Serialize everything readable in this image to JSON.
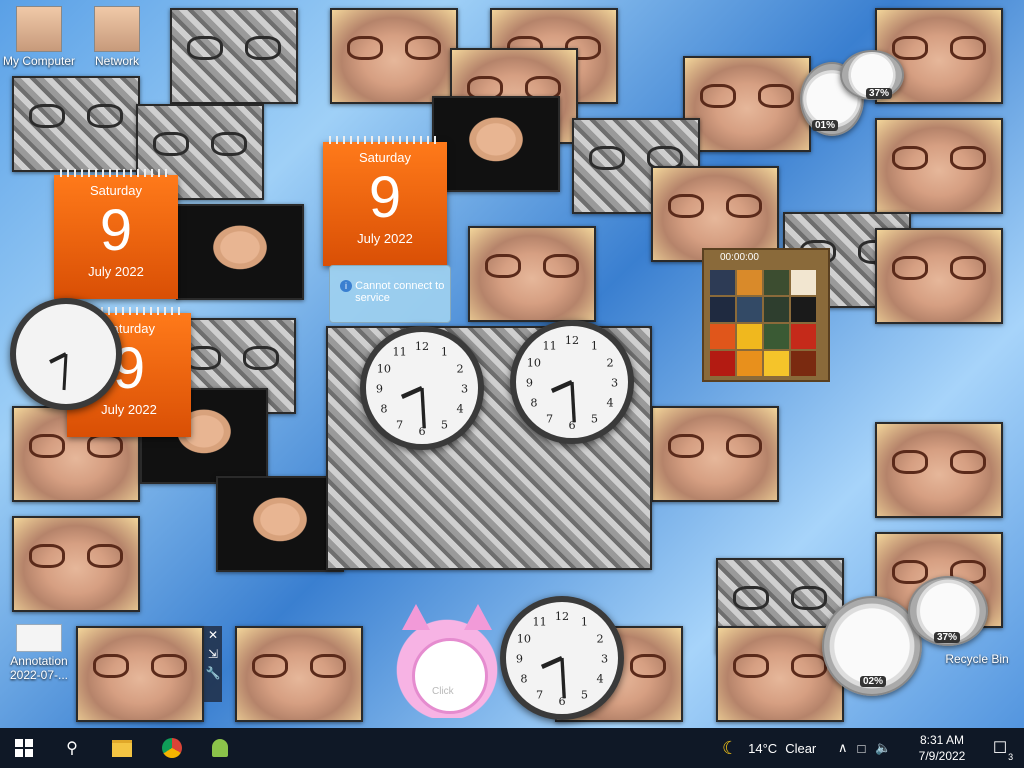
{
  "desktop": {
    "icons": [
      {
        "label": "My Computer"
      },
      {
        "label": "Network"
      },
      {
        "label": "Annotation 2022-07-..."
      },
      {
        "label": "Recycle Bin"
      }
    ]
  },
  "calendars": [
    {
      "day": "Saturday",
      "date": "9",
      "month": "July 2022"
    },
    {
      "day": "Saturday",
      "date": "9",
      "month": "July 2022"
    },
    {
      "day": "Saturday",
      "date": "9",
      "month": "July 2022"
    }
  ],
  "toast": {
    "text": "Cannot connect to service"
  },
  "puzzle": {
    "timer": "00:00:00"
  },
  "gauges": [
    {
      "cpu": "01%",
      "mem": "37%"
    },
    {
      "cpu": "02%",
      "mem": "37%"
    }
  ],
  "cat_clock": {
    "label": "Click"
  },
  "side_controls": {
    "close": "✕",
    "resize": "⇲",
    "settings": "🔧"
  },
  "taskbar": {
    "weather_temp": "14°C",
    "weather_desc": "Clear",
    "time": "8:31 AM",
    "date": "7/9/2022",
    "notifications": "3"
  },
  "colors": {
    "calendar": "#e8620d",
    "taskbar": "#0f1826"
  }
}
